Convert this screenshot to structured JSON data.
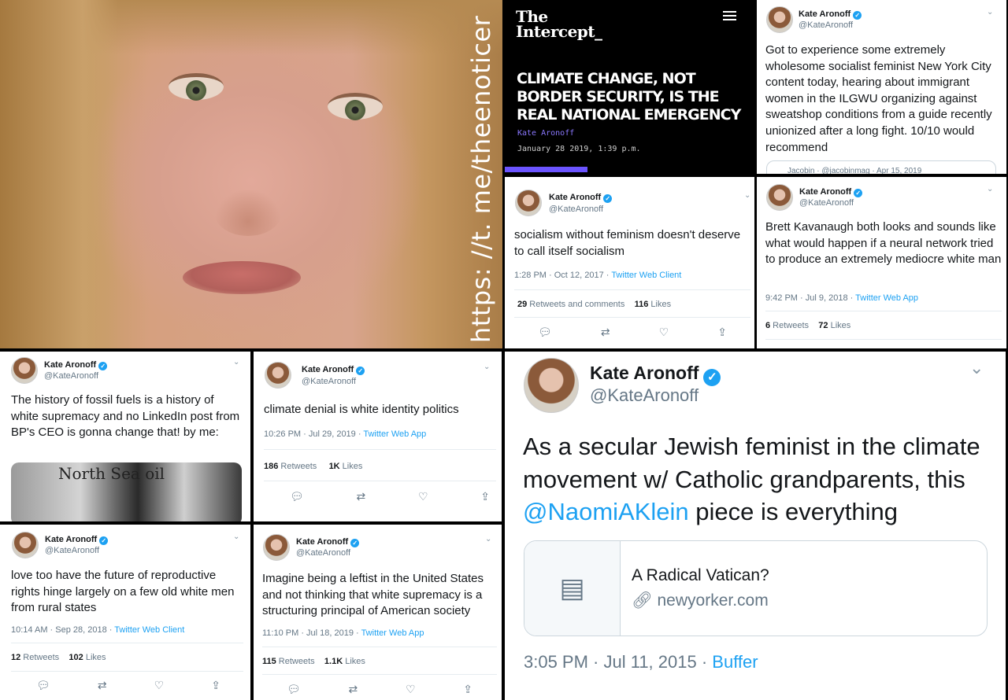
{
  "watermark": "https: //t. me/theenoticer",
  "intercept": {
    "logo_line1": "The",
    "logo_line2": "Intercept_",
    "headline": "CLIMATE CHANGE, NOT BORDER SECURITY, IS THE REAL NATIONAL EMERGENCY",
    "author": "Kate Aronoff",
    "date": "January 28 2019, 1:39 p.m.",
    "accent_color": "#6b54ff"
  },
  "author": {
    "name": "Kate Aronoff",
    "handle": "@KateAronoff",
    "verified_icon": "verified-badge-icon"
  },
  "tweets": {
    "t1": {
      "text": "Got to experience some extremely wholesome socialist feminist New York City content today, hearing about immigrant women in the ILGWU organizing against sweatshop conditions from a guide recently unionized after a long fight. 10/10 would recommend",
      "quote_partial": "Jacobin · @jacobinmag · Apr 15, 2019"
    },
    "t2": {
      "text": "socialism without feminism doesn't deserve to call itself socialism",
      "time": "1:28 PM · Oct 12, 2017 · ",
      "source": "Twitter Web Client",
      "rt_count": "29",
      "rt_label": " Retweets and comments",
      "likes_count": "116",
      "likes_label": " Likes"
    },
    "t3": {
      "text": "Brett Kavanaugh both looks and sounds like what would happen if a neural network tried to produce an extremely mediocre white man",
      "time": "9:42 PM · Jul 9, 2018 · ",
      "source": "Twitter Web App",
      "rt_count": "6",
      "rt_label": " Retweets",
      "likes_count": "72",
      "likes_label": " Likes"
    },
    "t4": {
      "text": "The history of fossil fuels is a history of white supremacy and no LinkedIn post from BP's CEO is gonna change that! by me:",
      "image_text": "North Sea oil"
    },
    "t5": {
      "text": "climate denial is white identity politics",
      "time": "10:26 PM · Jul 29, 2019 · ",
      "source": "Twitter Web App",
      "rt_count": "186",
      "rt_label": " Retweets",
      "likes_count": "1K",
      "likes_label": " Likes"
    },
    "t6": {
      "text": "love too have the future of reproductive rights hinge largely on a few old white men from rural states",
      "time": "10:14 AM · Sep 28, 2018 · ",
      "source": "Twitter Web Client",
      "rt_count": "12",
      "rt_label": " Retweets",
      "likes_count": "102",
      "likes_label": " Likes"
    },
    "t7": {
      "text": "Imagine being a leftist in the United States and not thinking that white supremacy is a structuring principal of American society",
      "time": "11:10 PM · Jul 18, 2019 · ",
      "source": "Twitter Web App",
      "rt_count": "115",
      "rt_label": " Retweets",
      "likes_count": "1.1K",
      "likes_label": " Likes"
    },
    "t8": {
      "text_before": "As a secular Jewish feminist in the climate movement w/ Catholic grandparents, this ",
      "mention": "@NaomiAKlein",
      "text_after": " piece is everything",
      "card_title": "A Radical Vatican?",
      "card_domain": "newyorker.com",
      "time": "3:05 PM · Jul 11, 2015 · ",
      "source": "Buffer"
    }
  },
  "colors": {
    "link": "#1da1f2",
    "muted": "#657786"
  },
  "icons": {
    "reply": "reply-icon",
    "retweet": "retweet-icon",
    "like": "heart-icon",
    "share": "share-icon",
    "chevron": "chevron-down-icon"
  }
}
